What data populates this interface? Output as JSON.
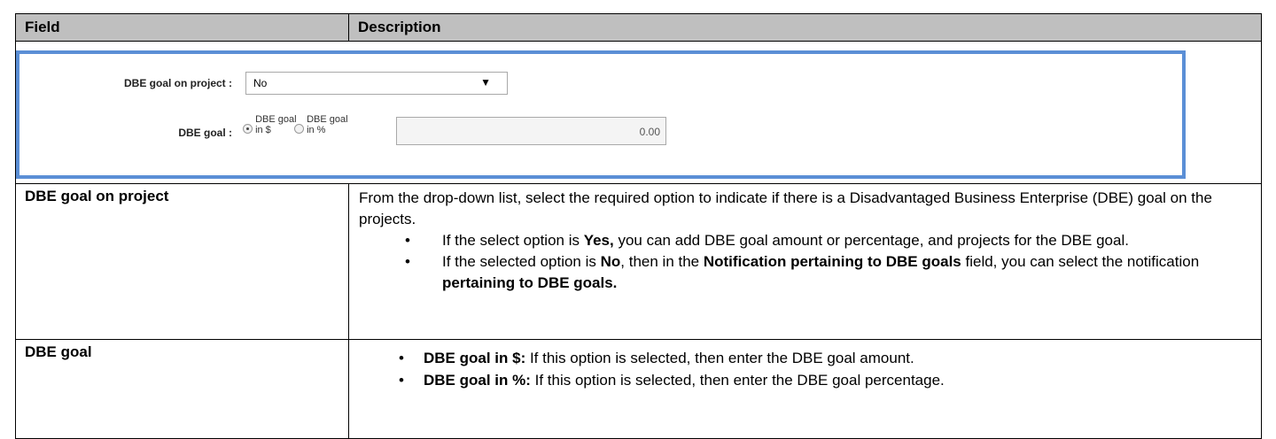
{
  "table": {
    "header": {
      "field": "Field",
      "description": "Description"
    },
    "screenshot": {
      "dbe_goal_on_project_label": "DBE goal on project :",
      "dbe_goal_on_project_value": "No",
      "dropdown_arrow": "▼",
      "dbe_goal_label": "DBE goal :",
      "radio_dollar_label": "DBE goal in $",
      "radio_percent_label": "DBE goal in %",
      "radio_dollar_selected": true,
      "amount_value": "0.00"
    },
    "rows": [
      {
        "field": "DBE goal on project",
        "intro": "From the drop-down list, select the required option to indicate if there is a Disadvantaged Business Enterprise (DBE) goal on the projects.",
        "bullets": [
          {
            "t1": "If the select option is ",
            "b1": "Yes,",
            "t2": " you can add DBE goal amount or percentage, and  projects for the DBE goal."
          },
          {
            "t1": "If the selected option is ",
            "b1": "No",
            "t2": ", then in the ",
            "b2": "Notification pertaining to DBE goals",
            "t3": " field,  you can select the notification ",
            "b3": "pertaining to DBE goals."
          }
        ]
      },
      {
        "field": "DBE goal",
        "bullets": [
          {
            "b1": "DBE goal in $:",
            "t1": " If this option is selected, then enter the DBE goal amount."
          },
          {
            "b1": "DBE goal in %:",
            "t1": " If this option is selected, then enter the DBE goal  percentage."
          }
        ]
      }
    ]
  },
  "colors": {
    "header_bg": "#bfbfbf",
    "frame_border": "#5b8fd6"
  },
  "icons": {
    "bullet": "•",
    "dropdown": "chevron-down-icon"
  }
}
